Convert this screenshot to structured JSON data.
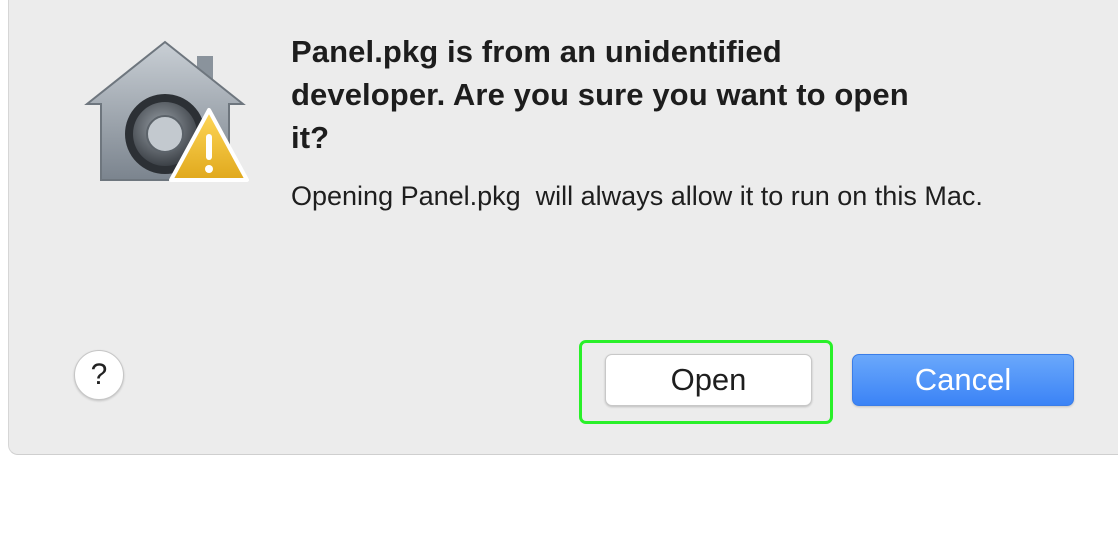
{
  "dialog": {
    "title": "Panel.pkg is from an unidentified developer. Are you sure you want to open it?",
    "message": "Opening Panel.pkg  will always allow it to run on this Mac.",
    "help_label": "?",
    "open_label": "Open",
    "cancel_label": "Cancel",
    "icon": "gatekeeper-warning-icon"
  },
  "colors": {
    "dialog_background": "#ececec",
    "cancel_button": "#3b83f6",
    "highlight_outline": "#29f029",
    "warning_triangle": "#f2c12e"
  }
}
